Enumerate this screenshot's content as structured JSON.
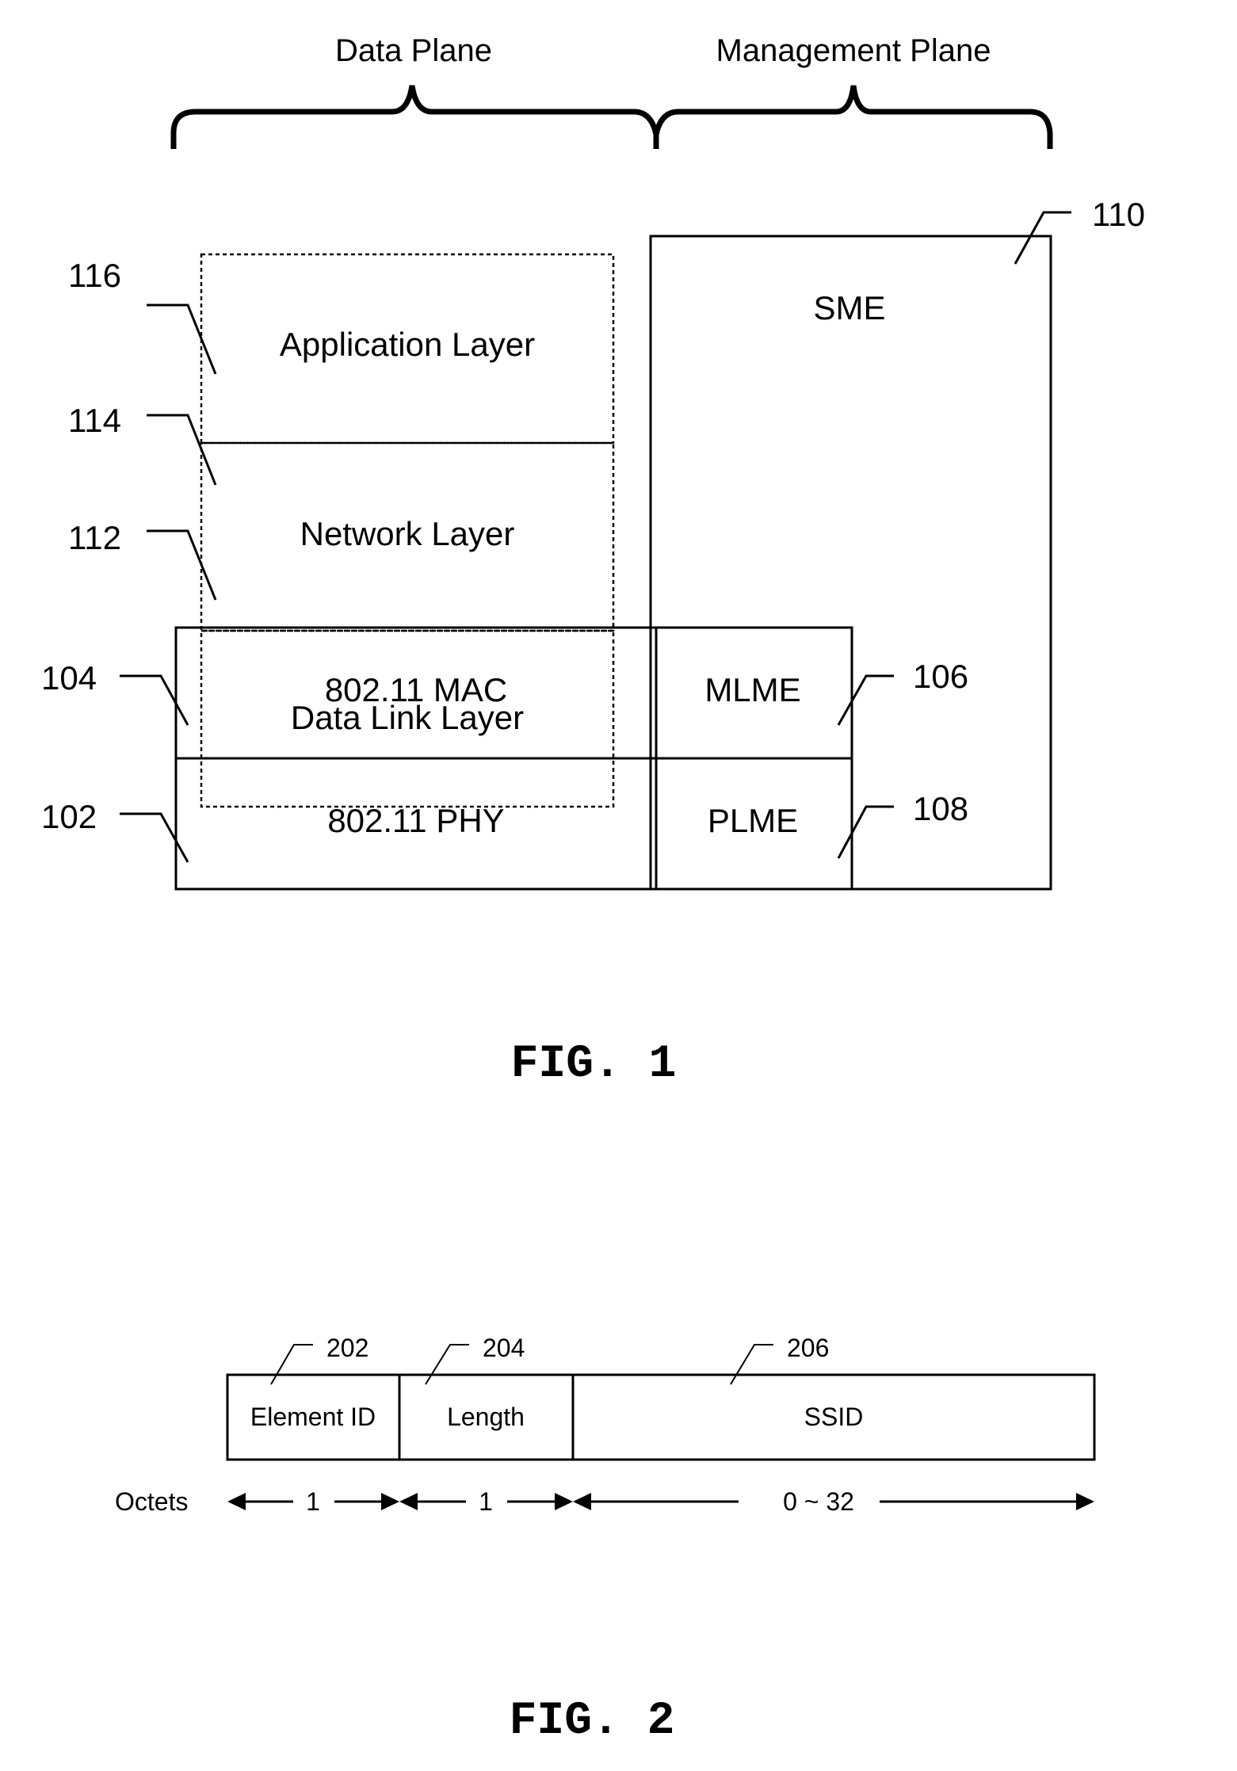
{
  "figure1": {
    "caption": "FIG. 1",
    "planes": {
      "data_plane": "Data Plane",
      "management_plane": "Management Plane"
    },
    "blocks": {
      "application_layer": {
        "label": "Application Layer",
        "ref": "116"
      },
      "network_layer": {
        "label": "Network Layer",
        "ref": "114"
      },
      "data_link_layer": {
        "label": "Data Link Layer",
        "ref": "112"
      },
      "mac": {
        "label": "802.11 MAC",
        "ref": "104"
      },
      "phy": {
        "label": "802.11 PHY",
        "ref": "102"
      },
      "mlme": {
        "label": "MLME",
        "ref": "106"
      },
      "plme": {
        "label": "PLME",
        "ref": "108"
      },
      "sme": {
        "label": "SME",
        "ref": "110"
      }
    }
  },
  "figure2": {
    "caption": "FIG. 2",
    "fields": [
      {
        "label": "Element ID",
        "ref": "202",
        "octets": "1"
      },
      {
        "label": "Length",
        "ref": "204",
        "octets": "1"
      },
      {
        "label": "SSID",
        "ref": "206",
        "octets": "0 ~ 32"
      }
    ],
    "octets_label": "Octets"
  }
}
